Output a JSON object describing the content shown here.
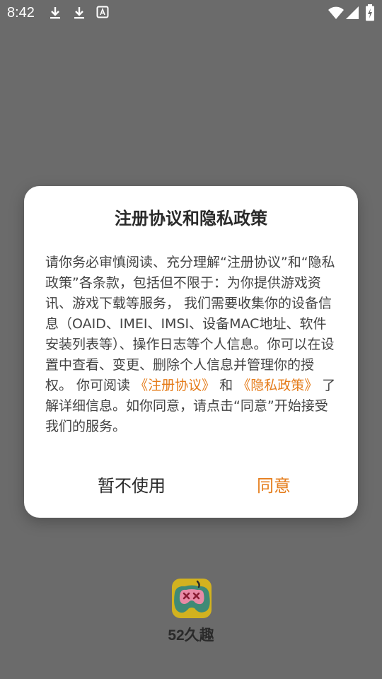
{
  "status_bar": {
    "time": "8:42",
    "icons": [
      "download-icon",
      "download-icon",
      "text-notification-icon",
      "wifi-icon",
      "signal-icon",
      "battery-icon"
    ]
  },
  "dialog": {
    "title": "注册协议和隐私政策",
    "body_before": "请你务必审慎阅读、充分理解“注册协议”和“隐私政策”各条款，包括但不限于：为你提供游戏资讯、游戏下载等服务， 我们需要收集你的设备信息（OAID、IMEI、IMSI、设备MAC地址、软件安装列表等）、操作日志等个人信息。你可以在设置中查看、变更、删除个人信息并管理你的授权。 你可阅读 ",
    "link_register": "《注册协议》",
    "body_and": " 和 ",
    "link_privacy": "《隐私政策》",
    "body_after": " 了解详细信息。如你同意，请点击“同意”开始接受我们的服务。",
    "decline_label": "暂不使用",
    "agree_label": "同意"
  },
  "app": {
    "name": "52久趣",
    "logo_icon": "gamepad-logo-icon"
  },
  "colors": {
    "accent": "#e57c1a",
    "overlay_background": "#6b6b6b",
    "dialog_background": "#ffffff",
    "logo_background": "#d2b21f",
    "logo_foreground": "#3f8a76"
  }
}
